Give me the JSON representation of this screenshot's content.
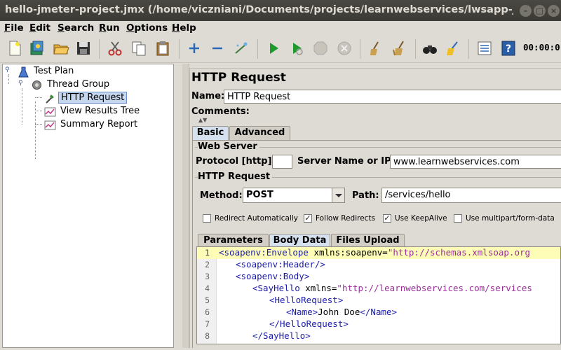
{
  "window": {
    "title": "hello-jmeter-project.jmx (/home/viczniani/Documents/projects/learnwebservices/lwsapp-jmeter-proj..."
  },
  "menubar": {
    "items": [
      {
        "label": "File",
        "mnemonic": "F",
        "rest": "ile"
      },
      {
        "label": "Edit",
        "mnemonic": "E",
        "rest": "dit"
      },
      {
        "label": "Search",
        "mnemonic": "S",
        "rest": "earch"
      },
      {
        "label": "Run",
        "mnemonic": "R",
        "rest": "un"
      },
      {
        "label": "Options",
        "mnemonic": "O",
        "rest": "ptions"
      },
      {
        "label": "Help",
        "mnemonic": "H",
        "rest": "elp"
      }
    ]
  },
  "toolbar": {
    "timer": "00:00:0"
  },
  "tree": {
    "items": [
      {
        "label": "Test Plan",
        "icon": "test-plan-icon"
      },
      {
        "label": "Thread Group",
        "icon": "gear-icon"
      },
      {
        "label": "HTTP Request",
        "icon": "pipette-icon"
      },
      {
        "label": "View Results Tree",
        "icon": "graph-icon"
      },
      {
        "label": "Summary Report",
        "icon": "graph-icon"
      }
    ]
  },
  "panel": {
    "title": "HTTP Request",
    "name_label": "Name:",
    "name_value": "HTTP Request",
    "comments_label": "Comments:",
    "tabs": [
      {
        "label": "Basic",
        "active": true
      },
      {
        "label": "Advanced",
        "active": false
      }
    ],
    "web_server": {
      "title": "Web Server",
      "protocol_label": "Protocol [http]:",
      "protocol_value": "",
      "server_label": "Server Name or IP:",
      "server_value": "www.learnwebservices.com"
    },
    "http_request": {
      "title": "HTTP Request",
      "method_label": "Method:",
      "method_value": "POST",
      "path_label": "Path:",
      "path_value": "/services/hello"
    },
    "checkboxes": [
      {
        "label": "Redirect Automatically",
        "checked": false
      },
      {
        "label": "Follow Redirects",
        "checked": true
      },
      {
        "label": "Use KeepAlive",
        "checked": true
      },
      {
        "label": "Use multipart/form-data",
        "checked": false
      }
    ],
    "subtabs": [
      {
        "label": "Parameters",
        "active": false
      },
      {
        "label": "Body Data",
        "active": true
      },
      {
        "label": "Files Upload",
        "active": false
      }
    ],
    "body_lines": [
      {
        "num": "1"
      },
      {
        "num": "2"
      },
      {
        "num": "3"
      },
      {
        "num": "4"
      },
      {
        "num": "5"
      },
      {
        "num": "6"
      },
      {
        "num": "7"
      },
      {
        "num": "8"
      }
    ],
    "body_tokens": {
      "l1_open": "<soapenv:Envelope",
      "l1_attr": " xmlns:soapenv=",
      "l1_str": "\"http://schemas.xmlsoap.org",
      "l2_tag": "<soapenv:Header/>",
      "l3_tag": "<soapenv:Body>",
      "l4_open": "<SayHello",
      "l4_attr": " xmlns=",
      "l4_str": "\"http://learnwebservices.com/services",
      "l5_tag": "<HelloRequest>",
      "l6_open": "<Name>",
      "l6_text": "John Doe",
      "l6_close": "</Name>",
      "l7_tag": "</HelloRequest>",
      "l8_tag": "</SayHello>"
    }
  }
}
